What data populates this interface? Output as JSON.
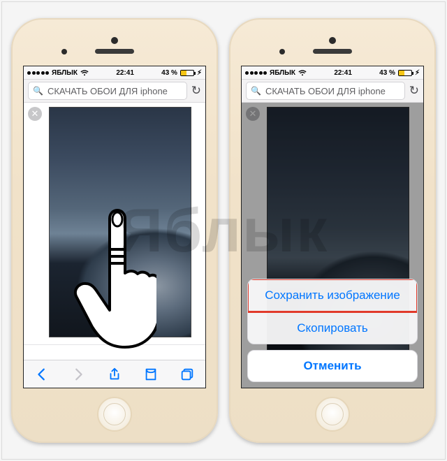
{
  "watermark": "Яблык",
  "status": {
    "carrier": "ЯБЛЫК",
    "time": "22:41",
    "battery_pct": "43 %"
  },
  "address_bar": {
    "query": "СКАЧАТЬ ОБОИ ДЛЯ iphone"
  },
  "action_sheet": {
    "save_image": "Сохранить изображение",
    "copy": "Скопировать",
    "cancel": "Отменить"
  },
  "colors": {
    "ios_blue": "#0076ff",
    "highlight_red": "#e13a2a",
    "battery_yellow": "#f5c516"
  }
}
